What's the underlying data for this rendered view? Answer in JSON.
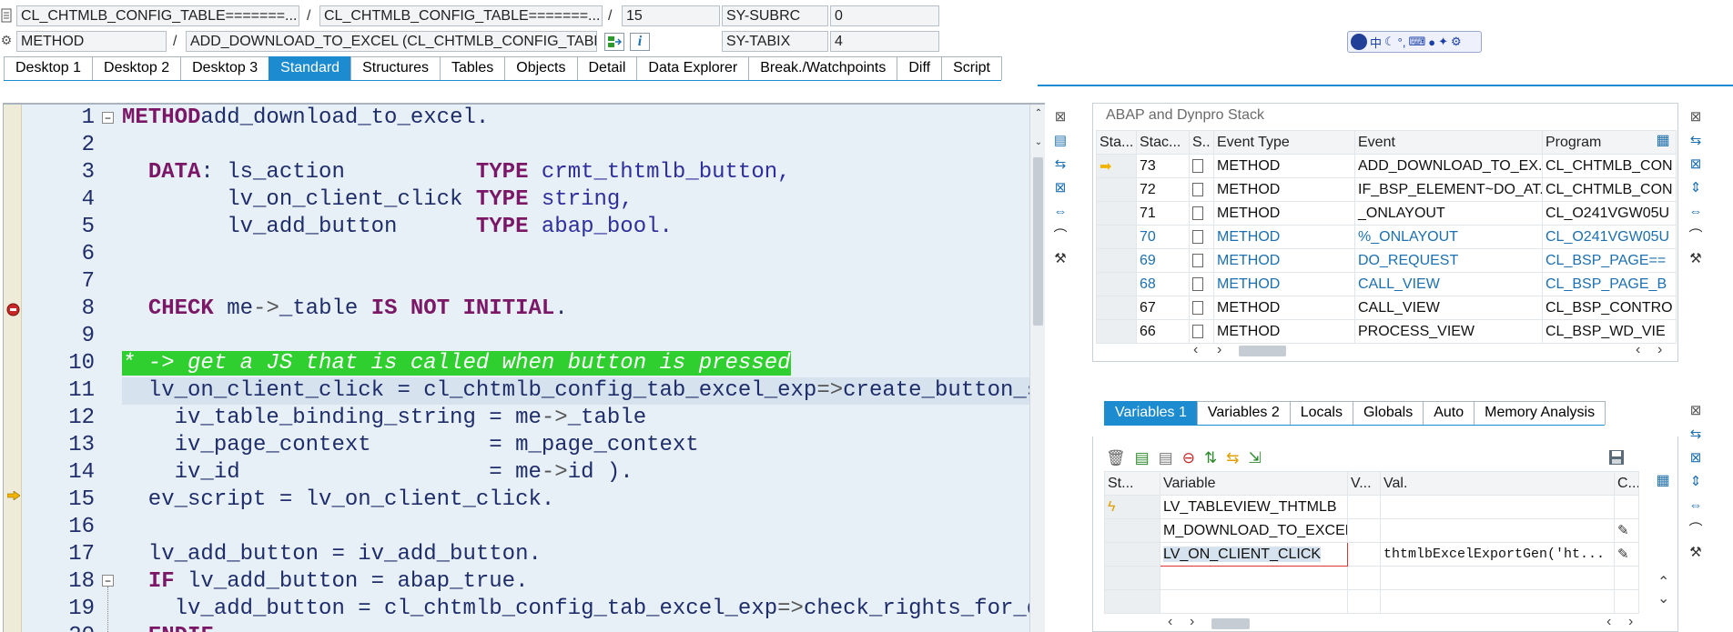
{
  "header": {
    "row1": {
      "field1": "CL_CHTMLB_CONFIG_TABLE=======...",
      "sep1": "/",
      "field2": "CL_CHTMLB_CONFIG_TABLE=======...",
      "sep2": "/",
      "line_no": "15",
      "sysvar_name": "SY-SUBRC",
      "sysvar_value": "0"
    },
    "row2": {
      "type": "METHOD",
      "sep": "/",
      "name": "ADD_DOWNLOAD_TO_EXCEL (CL_CHTMLB_CONFIG_TABLE)",
      "sysvar_name": "SY-TABIX",
      "sysvar_value": "4"
    }
  },
  "tabs": [
    "Desktop 1",
    "Desktop 2",
    "Desktop 3",
    "Standard",
    "Structures",
    "Tables",
    "Objects",
    "Detail",
    "Data Explorer",
    "Break./Watchpoints",
    "Diff",
    "Script"
  ],
  "active_tab": "Standard",
  "editor": {
    "line_numbers": [
      "1",
      "2",
      "3",
      "4",
      "5",
      "6",
      "7",
      "8",
      "9",
      "10",
      "11",
      "12",
      "13",
      "14",
      "15",
      "16",
      "17",
      "18",
      "19",
      "20"
    ],
    "lines": [
      [
        [
          "kw",
          "METHOD"
        ],
        [
          "",
          "add_download_to_excel."
        ]
      ],
      [],
      [
        [
          "",
          "  "
        ],
        [
          "kw",
          "DATA"
        ],
        [
          "",
          ": ls_action          "
        ],
        [
          "kw",
          "TYPE"
        ],
        [
          "ty",
          " crmt_thtmlb_button,"
        ]
      ],
      [
        [
          "",
          "        lv_on_client_click "
        ],
        [
          "kw",
          "TYPE"
        ],
        [
          "ty",
          " string,"
        ]
      ],
      [
        [
          "",
          "        lv_add_button      "
        ],
        [
          "kw",
          "TYPE"
        ],
        [
          "ty",
          " abap_bool."
        ]
      ],
      [],
      [],
      [
        [
          "",
          "  "
        ],
        [
          "kw",
          "CHECK"
        ],
        [
          "",
          " me"
        ],
        [
          "sym",
          "->"
        ],
        [
          "",
          "_table "
        ],
        [
          "kw",
          "IS NOT INITIAL"
        ],
        [
          "",
          "."
        ]
      ],
      [],
      [
        [
          "cmt",
          "* -> get a JS that is called when button is pressed"
        ]
      ],
      [
        [
          "",
          "  lv_on_client_click = cl_chtmlb_config_tab_excel_exp"
        ],
        [
          "sym",
          "=>"
        ],
        [
          "",
          "create_button_script("
        ]
      ],
      [
        [
          "",
          "    iv_table_binding_string = me"
        ],
        [
          "sym",
          "->"
        ],
        [
          "",
          "_table"
        ]
      ],
      [
        [
          "",
          "    iv_page_context         = m_page_context"
        ]
      ],
      [
        [
          "",
          "    iv_id                   = me"
        ],
        [
          "sym",
          "->"
        ],
        [
          "",
          "id )."
        ]
      ],
      [
        [
          "",
          "  ev_script = lv_on_client_click."
        ]
      ],
      [],
      [
        [
          "",
          "  lv_add_button = iv_add_button."
        ]
      ],
      [
        [
          "",
          "  "
        ],
        [
          "kw",
          "IF"
        ],
        [
          "",
          " lv_add_button = abap_true."
        ]
      ],
      [
        [
          "",
          "    lv_add_button = cl_chtmlb_config_tab_excel_exp"
        ],
        [
          "sym",
          "=>"
        ],
        [
          "",
          "check_rights_for_download( )."
        ]
      ],
      [
        [
          "",
          "  "
        ],
        [
          "kw",
          "ENDIF"
        ],
        [
          "",
          "."
        ]
      ]
    ]
  },
  "stack": {
    "title": "ABAP and Dynpro Stack",
    "columns": [
      "Sta...",
      "Stac...",
      "S..",
      "Event Type",
      "Event",
      "Program"
    ],
    "rows": [
      {
        "level": "73",
        "type": "METHOD",
        "event": "ADD_DOWNLOAD_TO_EX...",
        "program": "CL_CHTMLB_CON",
        "current": true,
        "blue": false
      },
      {
        "level": "72",
        "type": "METHOD",
        "event": "IF_BSP_ELEMENT~DO_AT...",
        "program": "CL_CHTMLB_CON",
        "current": false,
        "blue": false
      },
      {
        "level": "71",
        "type": "METHOD",
        "event": "_ONLAYOUT",
        "program": "CL_O241VGW05U",
        "current": false,
        "blue": false
      },
      {
        "level": "70",
        "type": "METHOD",
        "event": "%_ONLAYOUT",
        "program": "CL_O241VGW05U",
        "current": false,
        "blue": true
      },
      {
        "level": "69",
        "type": "METHOD",
        "event": "DO_REQUEST",
        "program": "CL_BSP_PAGE==",
        "current": false,
        "blue": true
      },
      {
        "level": "68",
        "type": "METHOD",
        "event": "CALL_VIEW",
        "program": "CL_BSP_PAGE_B",
        "current": false,
        "blue": true
      },
      {
        "level": "67",
        "type": "METHOD",
        "event": "CALL_VIEW",
        "program": "CL_BSP_CONTRO",
        "current": false,
        "blue": false
      },
      {
        "level": "66",
        "type": "METHOD",
        "event": "PROCESS_VIEW",
        "program": "CL_BSP_WD_VIE",
        "current": false,
        "blue": false
      }
    ]
  },
  "variables": {
    "tabs": [
      "Variables 1",
      "Variables 2",
      "Locals",
      "Globals",
      "Auto",
      "Memory Analysis"
    ],
    "active_tab": "Variables 1",
    "columns": [
      "St...",
      "Variable",
      "V...",
      "Val.",
      "C..."
    ],
    "rows": [
      {
        "variable": "LV_TABLEVIEW_THTMLB",
        "value": ""
      },
      {
        "variable": "M_DOWNLOAD_TO_EXCEL",
        "value": ""
      },
      {
        "variable": "LV_ON_CLIENT_CLICK",
        "value": "thtmlbExcelExportGen('ht..."
      }
    ]
  },
  "colors": {
    "accent": "#1c8bd0",
    "comment_bg": "#2fcf2f",
    "keyword": "#7b1767",
    "editor_bg": "#e7f0f6"
  }
}
